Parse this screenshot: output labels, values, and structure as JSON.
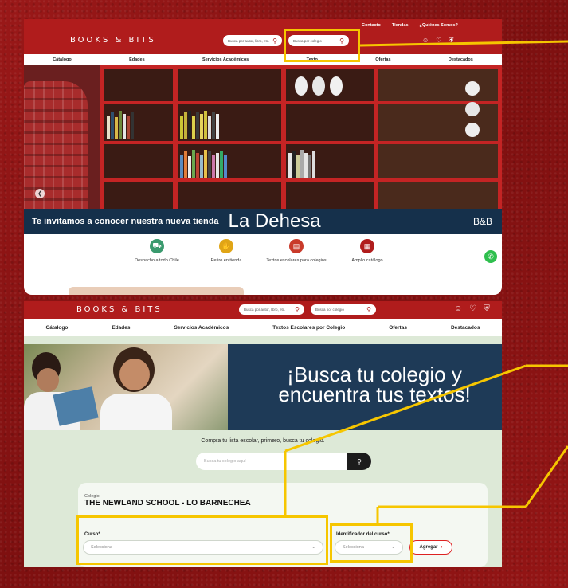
{
  "colors": {
    "brand_red": "#b01c1c",
    "navy": "#15304b",
    "highlight": "#f6c600",
    "mint": "#dde9d7"
  },
  "top": {
    "brand": "BOOKS & BITS",
    "links": [
      "Contacto",
      "Tiendas",
      "¿Quiénes Somos?"
    ],
    "search_author_placeholder": "Busca por autor, libro, etc.",
    "search_school_placeholder": "Busca por colegio",
    "nav": [
      "Cátalogo",
      "Edades",
      "Servicios Académicos",
      "Texto",
      "Ofertas",
      "Destacados"
    ],
    "banner_text": "Te invitamos a conocer nuestra nueva tienda",
    "banner_big": "La Dehesa",
    "banner_logo": "B&B",
    "features": [
      {
        "icon": "truck-icon",
        "label": "Despacho a todo Chile"
      },
      {
        "icon": "hand-icon",
        "label": "Retiro en tienda"
      },
      {
        "icon": "book-icon",
        "label": "Textos escolares para colegios"
      },
      {
        "icon": "books-icon",
        "label": "Amplio catálogo"
      }
    ]
  },
  "bottom": {
    "brand": "BOOKS & BITS",
    "search_author_placeholder": "Busca por autor, libro, etc.",
    "search_school_placeholder": "Busca por colegio",
    "nav": [
      "Cátalogo",
      "Edades",
      "Servicios Académicos",
      "Textos Escolares por Colegio",
      "Ofertas",
      "Destacados"
    ],
    "hero_line1": "¡Busca tu colegio y",
    "hero_line2": "encuentra tus textos!",
    "intro": "Compra tu lista escolar, primero, busca tu colegio.",
    "school_search_placeholder": "Busca tu colegio aquí",
    "school_caption": "Colegio",
    "school_name": "THE NEWLAND SCHOOL - LO BARNECHEA",
    "curso_label": "Curso*",
    "curso_value": "Selecciona",
    "ident_label": "Identificador del curso*",
    "ident_value": "Selecciona",
    "add_button": "Agregar"
  }
}
